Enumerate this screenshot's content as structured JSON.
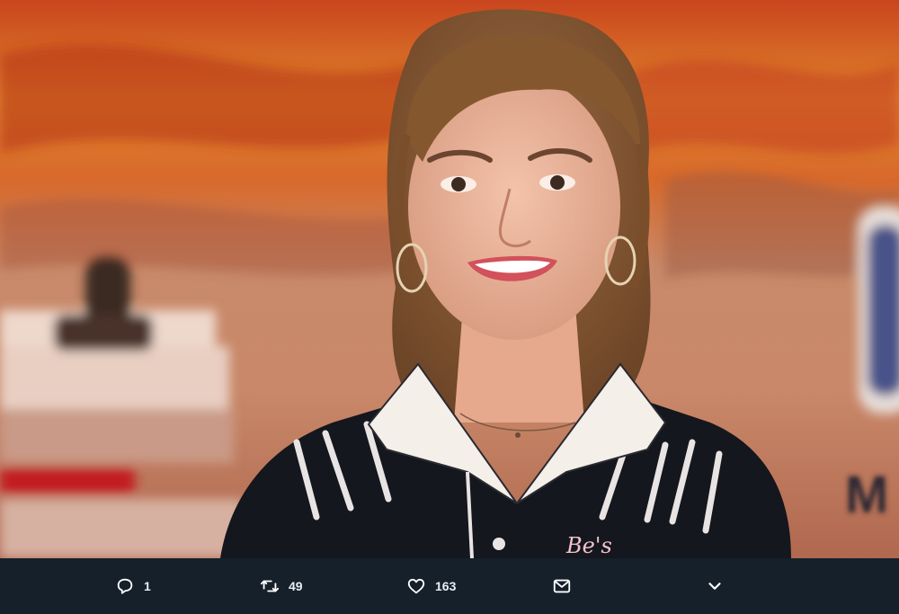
{
  "media": {
    "description_icon": "photo",
    "visible_text": [
      "M",
      "Be's"
    ]
  },
  "actions": {
    "reply": {
      "icon": "reply-icon",
      "count": "1"
    },
    "retweet": {
      "icon": "retweet-icon",
      "count": "49"
    },
    "like": {
      "icon": "heart-icon",
      "count": "163"
    },
    "dm": {
      "icon": "envelope-icon"
    },
    "more": {
      "icon": "chevron-down-icon"
    }
  },
  "colors": {
    "bar_background": "#15202b",
    "icon": "#ffffff"
  }
}
